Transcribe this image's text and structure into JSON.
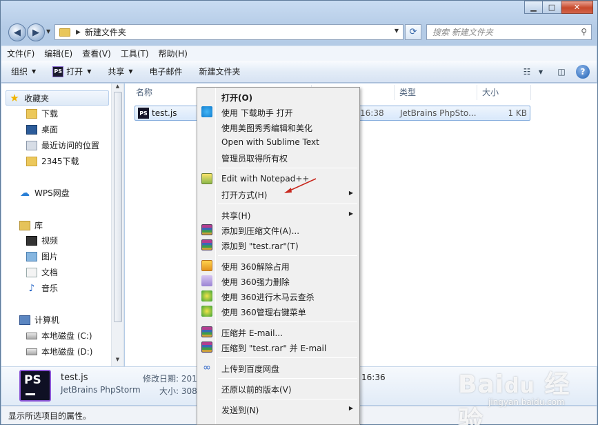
{
  "window": {
    "minimize": "▁",
    "maximize": "□",
    "close": "✕"
  },
  "address": {
    "path": "新建文件夹",
    "search_placeholder": "搜索 新建文件夹"
  },
  "menubar": [
    "文件(F)",
    "编辑(E)",
    "查看(V)",
    "工具(T)",
    "帮助(H)"
  ],
  "commands": {
    "organize": "组织",
    "open": "打开",
    "share": "共享",
    "email": "电子邮件",
    "new_folder": "新建文件夹"
  },
  "nav": {
    "favorites": "收藏夹",
    "downloads": "下载",
    "desktop": "桌面",
    "recent": "最近访问的位置",
    "dl2345": "2345下载",
    "wps": "WPS网盘",
    "library": "库",
    "videos": "视频",
    "pictures": "图片",
    "documents": "文档",
    "music": "音乐",
    "computer": "计算机",
    "drive_c": "本地磁盘 (C:)",
    "drive_d": "本地磁盘 (D:)"
  },
  "columns": {
    "name": "名称",
    "type": "类型",
    "size": "大小"
  },
  "file": {
    "icon_text": "PS",
    "name": "test.js",
    "date_partial": "16:38",
    "type": "JetBrains PhpSto...",
    "size": "1 KB"
  },
  "details": {
    "icon_text": "PS",
    "name": "test.js",
    "app": "JetBrains PhpStorm",
    "modified_label": "修改日期: 201",
    "size_label": "大小: 308",
    "time_partial": "16:36"
  },
  "status": "显示所选项目的属性。",
  "context_menu": {
    "open": "打开(O)",
    "open_dl": "使用 下载助手 打开",
    "meitu": "使用美图秀秀编辑和美化",
    "sublime": "Open with Sublime Text",
    "admin": "管理员取得所有权",
    "notepad": "Edit with Notepad++",
    "open_with": "打开方式(H)",
    "share": "共享(H)",
    "add_archive": "添加到压缩文件(A)...",
    "add_rar": "添加到 \"test.rar\"(T)",
    "unlock360": "使用 360解除占用",
    "delete360": "使用 360强力删除",
    "scan360": "使用 360进行木马云查杀",
    "menu360": "使用 360管理右键菜单",
    "zip_email": "压缩并 E-mail...",
    "zip_rar_email": "压缩到 \"test.rar\" 并 E-mail",
    "baidu": "上传到百度网盘",
    "restore": "还原以前的版本(V)",
    "send_to": "发送到(N)"
  },
  "colors": {
    "selection": "#d8e8fb",
    "annotation_arrow": "#c8281e"
  }
}
